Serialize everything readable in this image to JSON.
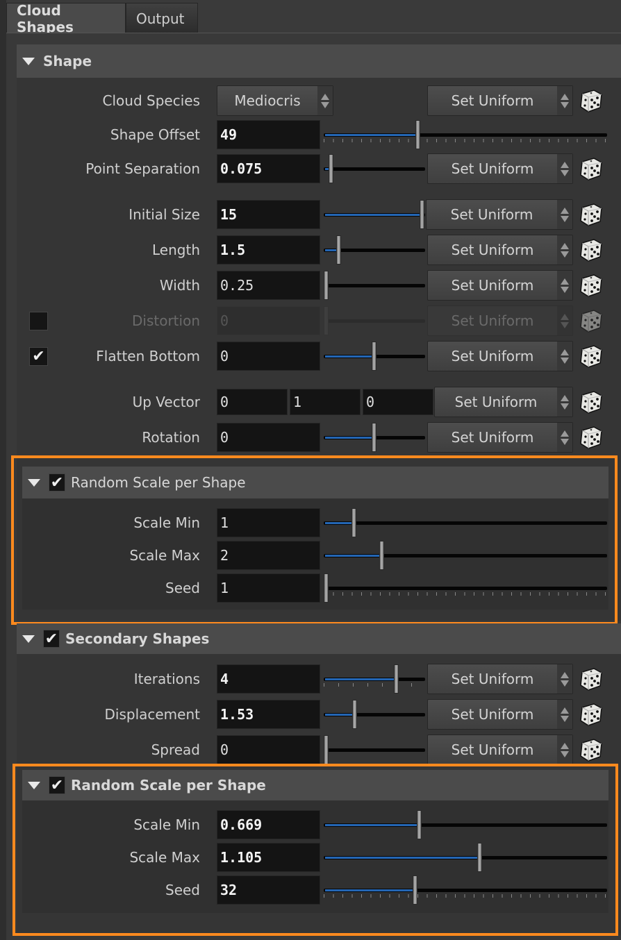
{
  "tabs": [
    {
      "label": "Cloud Shapes",
      "active": true
    },
    {
      "label": "Output",
      "active": false
    }
  ],
  "colors": {
    "accent_fill": "#2466b4",
    "highlight_box": "#ff8a1e"
  },
  "icons": {
    "dice": "dice-icon",
    "expand": "triangle-down-icon",
    "check": "checkmark-icon",
    "spinner": "up-down-arrows-icon"
  },
  "shape": {
    "title": "Shape",
    "cloud_species": {
      "label": "Cloud Species",
      "value": "Mediocris",
      "uniform": "Set Uniform"
    },
    "shape_offset": {
      "label": "Shape Offset",
      "value": "49",
      "slider": 0.33
    },
    "point_separation": {
      "label": "Point Separation",
      "value": "0.075",
      "slider": 0.05,
      "uniform": "Set Uniform"
    },
    "initial_size": {
      "label": "Initial Size",
      "value": "15",
      "slider": 1.0,
      "uniform": "Set Uniform"
    },
    "length": {
      "label": "Length",
      "value": "1.5",
      "slider": 0.13,
      "uniform": "Set Uniform"
    },
    "width": {
      "label": "Width",
      "value": "0.25",
      "slider": 0.0,
      "uniform": "Set Uniform"
    },
    "distortion": {
      "label": "Distortion",
      "value": "0",
      "slider": 0.0,
      "uniform": "Set Uniform",
      "enabled": false
    },
    "flatten_bottom": {
      "label": "Flatten Bottom",
      "value": "0",
      "slider": 0.5,
      "uniform": "Set Uniform",
      "enabled": true
    },
    "up_vector": {
      "label": "Up Vector",
      "x": "0",
      "y": "1",
      "z": "0",
      "uniform": "Set Uniform"
    },
    "rotation": {
      "label": "Rotation",
      "value": "0",
      "slider": 0.5,
      "uniform": "Set Uniform"
    },
    "random_scale": {
      "title": "Random Scale per Shape",
      "enabled": true,
      "scale_min": {
        "label": "Scale Min",
        "value": "1",
        "slider": 0.1
      },
      "scale_max": {
        "label": "Scale Max",
        "value": "2",
        "slider": 0.2
      },
      "seed": {
        "label": "Seed",
        "value": "1",
        "slider": 0.0
      }
    }
  },
  "secondary": {
    "title": "Secondary Shapes",
    "enabled": true,
    "iterations": {
      "label": "Iterations",
      "value": "4",
      "slider": 0.73,
      "uniform": "Set Uniform"
    },
    "displacement": {
      "label": "Displacement",
      "value": "1.53",
      "slider": 0.3,
      "uniform": "Set Uniform"
    },
    "spread": {
      "label": "Spread",
      "value": "0",
      "slider": 0.0,
      "uniform": "Set Uniform"
    },
    "random_scale": {
      "title": "Random Scale per Shape",
      "enabled": true,
      "scale_min": {
        "label": "Scale Min",
        "value": "0.669",
        "slider": 0.335
      },
      "scale_max": {
        "label": "Scale Max",
        "value": "1.105",
        "slider": 0.553
      },
      "seed": {
        "label": "Seed",
        "value": "32",
        "slider": 0.32
      }
    }
  }
}
